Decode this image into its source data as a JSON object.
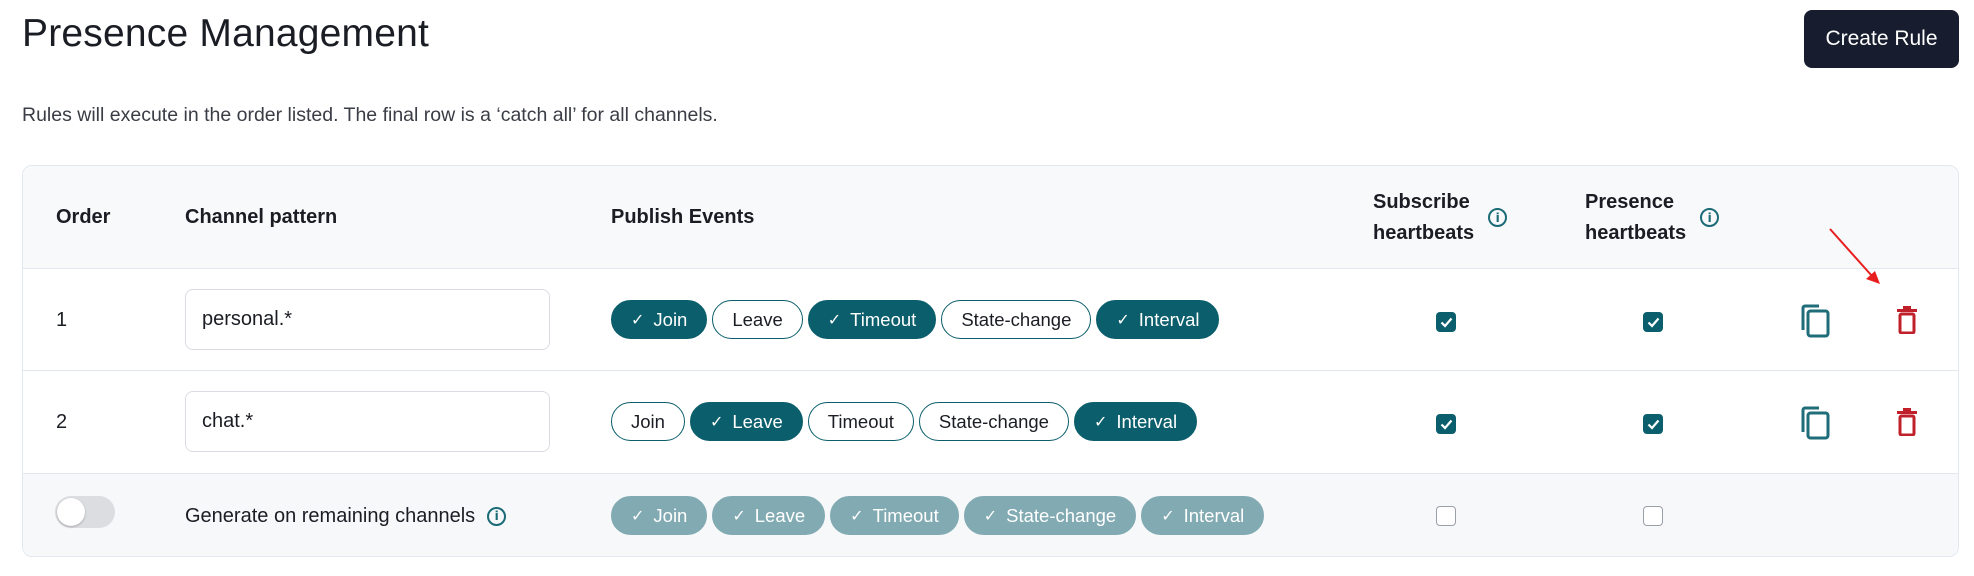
{
  "page": {
    "title": "Presence Management",
    "subtitle": "Rules will execute in the order listed. The final row is a ‘catch all’ for all channels.",
    "create_button": "Create Rule"
  },
  "colors": {
    "accent": "#0b5e6b",
    "accent_disabled": "#82aab2",
    "danger": "#c0202a",
    "button_dark": "#171c2e",
    "annotation_arrow": "#e81e1e"
  },
  "table": {
    "headers": {
      "order": "Order",
      "channel_pattern": "Channel pattern",
      "publish_events": "Publish Events",
      "subscribe_heartbeats_1": "Subscribe",
      "subscribe_heartbeats_2": "heartbeats",
      "presence_heartbeats_1": "Presence",
      "presence_heartbeats_2": "heartbeats"
    },
    "rows": [
      {
        "order": "1",
        "pattern": "personal.*",
        "events": [
          {
            "label": "Join",
            "selected": true
          },
          {
            "label": "Leave",
            "selected": false
          },
          {
            "label": "Timeout",
            "selected": true
          },
          {
            "label": "State-change",
            "selected": false
          },
          {
            "label": "Interval",
            "selected": true
          }
        ],
        "subscribe_heartbeats": true,
        "presence_heartbeats": true
      },
      {
        "order": "2",
        "pattern": "chat.*",
        "events": [
          {
            "label": "Join",
            "selected": false
          },
          {
            "label": "Leave",
            "selected": true
          },
          {
            "label": "Timeout",
            "selected": false
          },
          {
            "label": "State-change",
            "selected": false
          },
          {
            "label": "Interval",
            "selected": true
          }
        ],
        "subscribe_heartbeats": true,
        "presence_heartbeats": true
      }
    ],
    "catch_all": {
      "enabled": false,
      "label": "Generate on remaining channels",
      "events": [
        {
          "label": "Join",
          "selected": true
        },
        {
          "label": "Leave",
          "selected": true
        },
        {
          "label": "Timeout",
          "selected": true
        },
        {
          "label": "State-change",
          "selected": true
        },
        {
          "label": "Interval",
          "selected": true
        }
      ],
      "subscribe_heartbeats": false,
      "presence_heartbeats": false
    }
  },
  "icons": {
    "check": "✓",
    "info": "i",
    "copy": "copy-icon",
    "delete": "trash-icon"
  }
}
